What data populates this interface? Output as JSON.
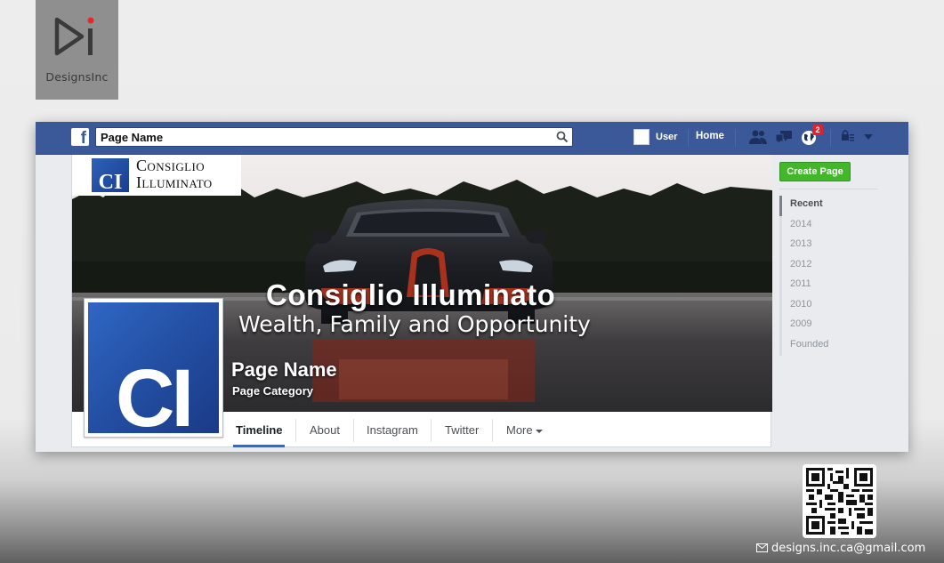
{
  "brand": {
    "name": "DesignsInc"
  },
  "topbar": {
    "search_value": "Page Name",
    "user_label": "User",
    "home_label": "Home",
    "notification_count": "2",
    "bar_color": "#3b5998"
  },
  "cover": {
    "logo_initials": "CI",
    "logo_line1": "Consiglio",
    "logo_line2": "Illuminato",
    "title": "Consiglio Illuminato",
    "subtitle": "Wealth, Family and Opportunity",
    "page_name": "Page Name",
    "page_category": "Page Category"
  },
  "profile": {
    "initials": "CI"
  },
  "tabs": [
    {
      "label": "Timeline"
    },
    {
      "label": "About"
    },
    {
      "label": "Instagram"
    },
    {
      "label": "Twitter"
    },
    {
      "label": "More"
    }
  ],
  "sidebar": {
    "create_page": "Create Page",
    "years": [
      "Recent",
      "2014",
      "2013",
      "2012",
      "2011",
      "2010",
      "2009",
      "Founded"
    ]
  },
  "contact": {
    "email": "designs.inc.ca@gmail.com"
  }
}
